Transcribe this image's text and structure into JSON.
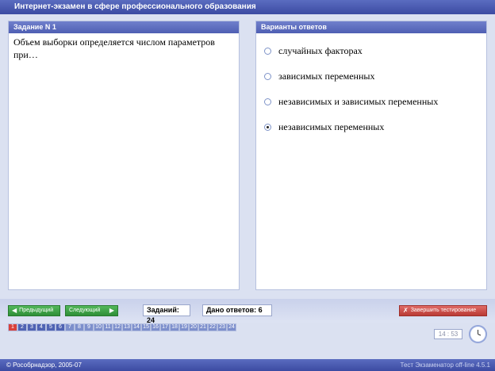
{
  "window": {
    "title": "Интернет-экзамен в сфере профессионального образования"
  },
  "question": {
    "header": "Задание N 1",
    "text": "Объем выборки определяется числом параметров при…"
  },
  "answers": {
    "header": "Варианты ответов",
    "options": [
      {
        "label": "случайных факторах",
        "selected": false
      },
      {
        "label": "зависимых переменных",
        "selected": false
      },
      {
        "label": "независимых и зависимых переменных",
        "selected": false
      },
      {
        "label": "независимых переменных",
        "selected": true
      }
    ]
  },
  "toolbar": {
    "prev_label": "Предыдущий",
    "next_label": "Следующий",
    "tasks_count": "Заданий: 24",
    "answers_given": "Дано ответов: 6",
    "finish_label": "Завершить тестирование"
  },
  "pager": {
    "pages": [
      "1",
      "2",
      "3",
      "4",
      "5",
      "6",
      "7",
      "8",
      "9",
      "10",
      "11",
      "12",
      "13",
      "14",
      "15",
      "16",
      "17",
      "18",
      "19",
      "20",
      "21",
      "22",
      "23",
      "24"
    ],
    "current": 1,
    "answered_count": 6
  },
  "timer": {
    "value": "14 : 53"
  },
  "status": {
    "copyright": "© Рособрнадзор, 2005-07",
    "version": "Тест Экзаменатор off-line 4.5.1"
  },
  "colors": {
    "accent": "#4f5fb3",
    "nav_green": "#2f8e38",
    "finish_red": "#b93a35",
    "current_page": "#d9413b"
  }
}
